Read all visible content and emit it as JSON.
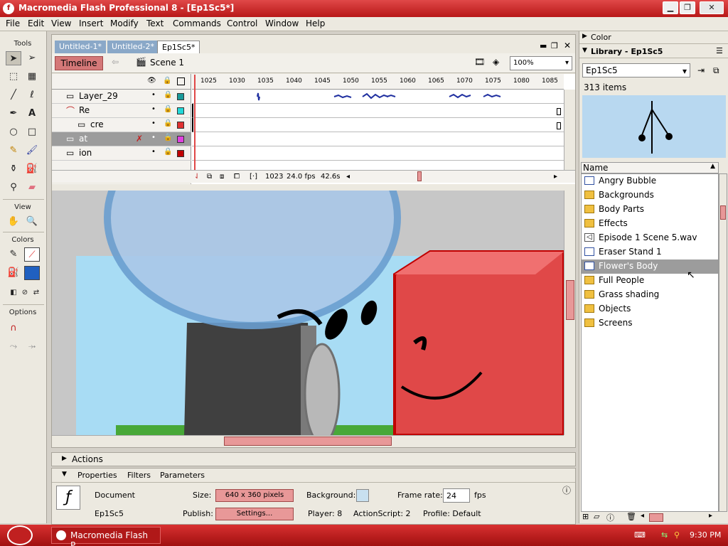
{
  "window": {
    "title": "Macromedia Flash Professional 8 - [Ep1Sc5*]",
    "app_icon": "flash-logo-icon"
  },
  "menu": [
    "File",
    "Edit",
    "View",
    "Insert",
    "Modify",
    "Text",
    "Commands",
    "Control",
    "Window",
    "Help"
  ],
  "tools": {
    "header": "Tools",
    "view_header": "View",
    "colors_header": "Colors",
    "options_header": "Options",
    "icons": [
      "selection-arrow-icon",
      "subselection-icon",
      "free-transform-icon",
      "gradient-transform-icon",
      "line-tool-icon",
      "lasso-icon",
      "pen-tool-icon",
      "text-tool-icon",
      "oval-tool-icon",
      "rectangle-tool-icon",
      "pencil-icon",
      "brush-icon",
      "ink-bottle-icon",
      "paint-bucket-icon",
      "eyedropper-icon",
      "eraser-icon",
      "hand-icon",
      "zoom-icon"
    ]
  },
  "document": {
    "tabs": [
      "Untitled-1*",
      "Untitled-2*",
      "Ep1Sc5*"
    ],
    "active_tab": 2,
    "timeline_button": "Timeline",
    "scene": "Scene 1",
    "zoom": "100%"
  },
  "timeline": {
    "ruler": [
      "1025",
      "1030",
      "1035",
      "1040",
      "1045",
      "1050",
      "1055",
      "1060",
      "1065",
      "1070",
      "1075",
      "1080",
      "1085"
    ],
    "layers": [
      {
        "name": "Layer_29",
        "color": "#1a9a9a",
        "type": "layer"
      },
      {
        "name": "Re",
        "color": "#22d8d8",
        "type": "mask"
      },
      {
        "name": "cre",
        "color": "#e03030",
        "type": "masked"
      },
      {
        "name": "at",
        "color": "#e040e0",
        "type": "layer",
        "selected": true
      },
      {
        "name": "ion",
        "color": "#c00000",
        "type": "layer"
      }
    ],
    "current_frame": "1023",
    "fps": "24.0 fps",
    "elapsed": "42.6s"
  },
  "panels": {
    "actions": "Actions",
    "properties_tabs": [
      "Properties",
      "Filters",
      "Parameters"
    ],
    "doc_type": "Document",
    "doc_name": "Ep1Sc5",
    "size_label": "Size:",
    "size_value": "640 x 360 pixels",
    "background_label": "Background:",
    "background_color": "#c8e0f0",
    "frame_rate_label": "Frame rate:",
    "frame_rate_value": "24",
    "fps_unit": "fps",
    "publish_label": "Publish:",
    "settings_button": "Settings...",
    "player": "Player: 8",
    "actionscript": "ActionScript: 2",
    "profile": "Profile: Default"
  },
  "library": {
    "color_panel": "Color",
    "title": "Library - Ep1Sc5",
    "selected_doc": "Ep1Sc5",
    "item_count": "313 items",
    "column_name": "Name",
    "items": [
      {
        "name": "Angry Bubble",
        "icon": "symbol-icon"
      },
      {
        "name": "Backgrounds",
        "icon": "folder-icon"
      },
      {
        "name": "Body Parts",
        "icon": "folder-icon"
      },
      {
        "name": "Effects",
        "icon": "folder-icon"
      },
      {
        "name": "Episode 1 Scene 5.wav",
        "icon": "sound-icon"
      },
      {
        "name": "Eraser Stand 1",
        "icon": "symbol-icon"
      },
      {
        "name": "Flower's Body",
        "icon": "symbol-icon",
        "selected": true
      },
      {
        "name": "Full People",
        "icon": "folder-icon"
      },
      {
        "name": "Grass shading",
        "icon": "folder-icon"
      },
      {
        "name": "Objects",
        "icon": "folder-icon"
      },
      {
        "name": "Screens",
        "icon": "folder-icon"
      }
    ]
  },
  "taskbar": {
    "task": "Macromedia Flash P...",
    "time": "9:30 PM"
  }
}
